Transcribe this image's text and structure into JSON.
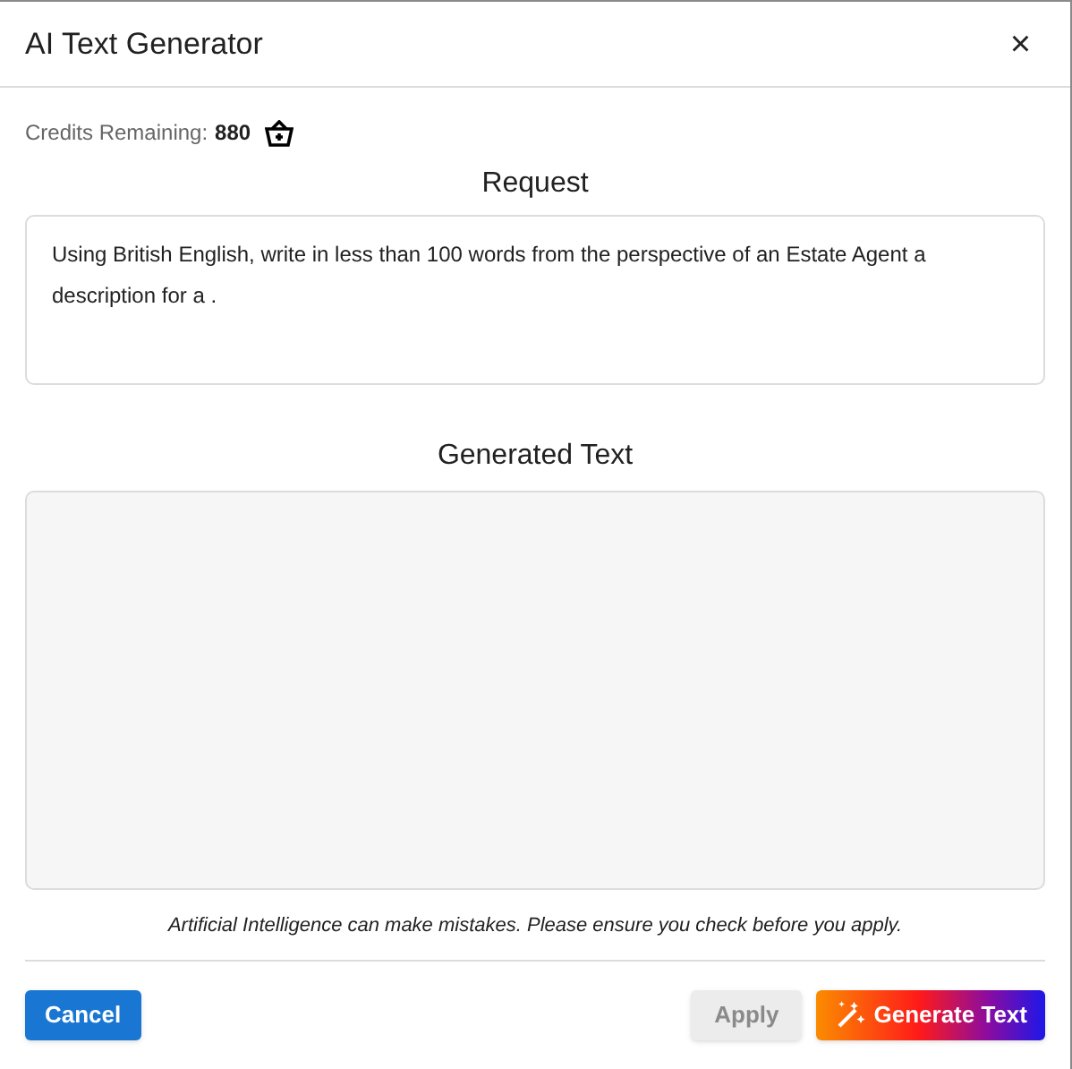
{
  "dialog": {
    "title": "AI Text Generator",
    "close": "×"
  },
  "credits": {
    "label": "Credits Remaining:",
    "value": "880"
  },
  "request": {
    "heading": "Request",
    "value": "Using British English, write in less than 100 words from the perspective of an Estate Agent a description for a ."
  },
  "generated": {
    "heading": "Generated Text"
  },
  "disclaimer": "Artificial Intelligence can make mistakes. Please ensure you check before you apply.",
  "buttons": [
    {
      "kind": "cancel",
      "label": "Cancel",
      "disabled": false
    },
    {
      "kind": "apply",
      "label": "Apply",
      "disabled": true
    },
    {
      "kind": "generate",
      "label": "Generate Text",
      "disabled": false
    }
  ]
}
